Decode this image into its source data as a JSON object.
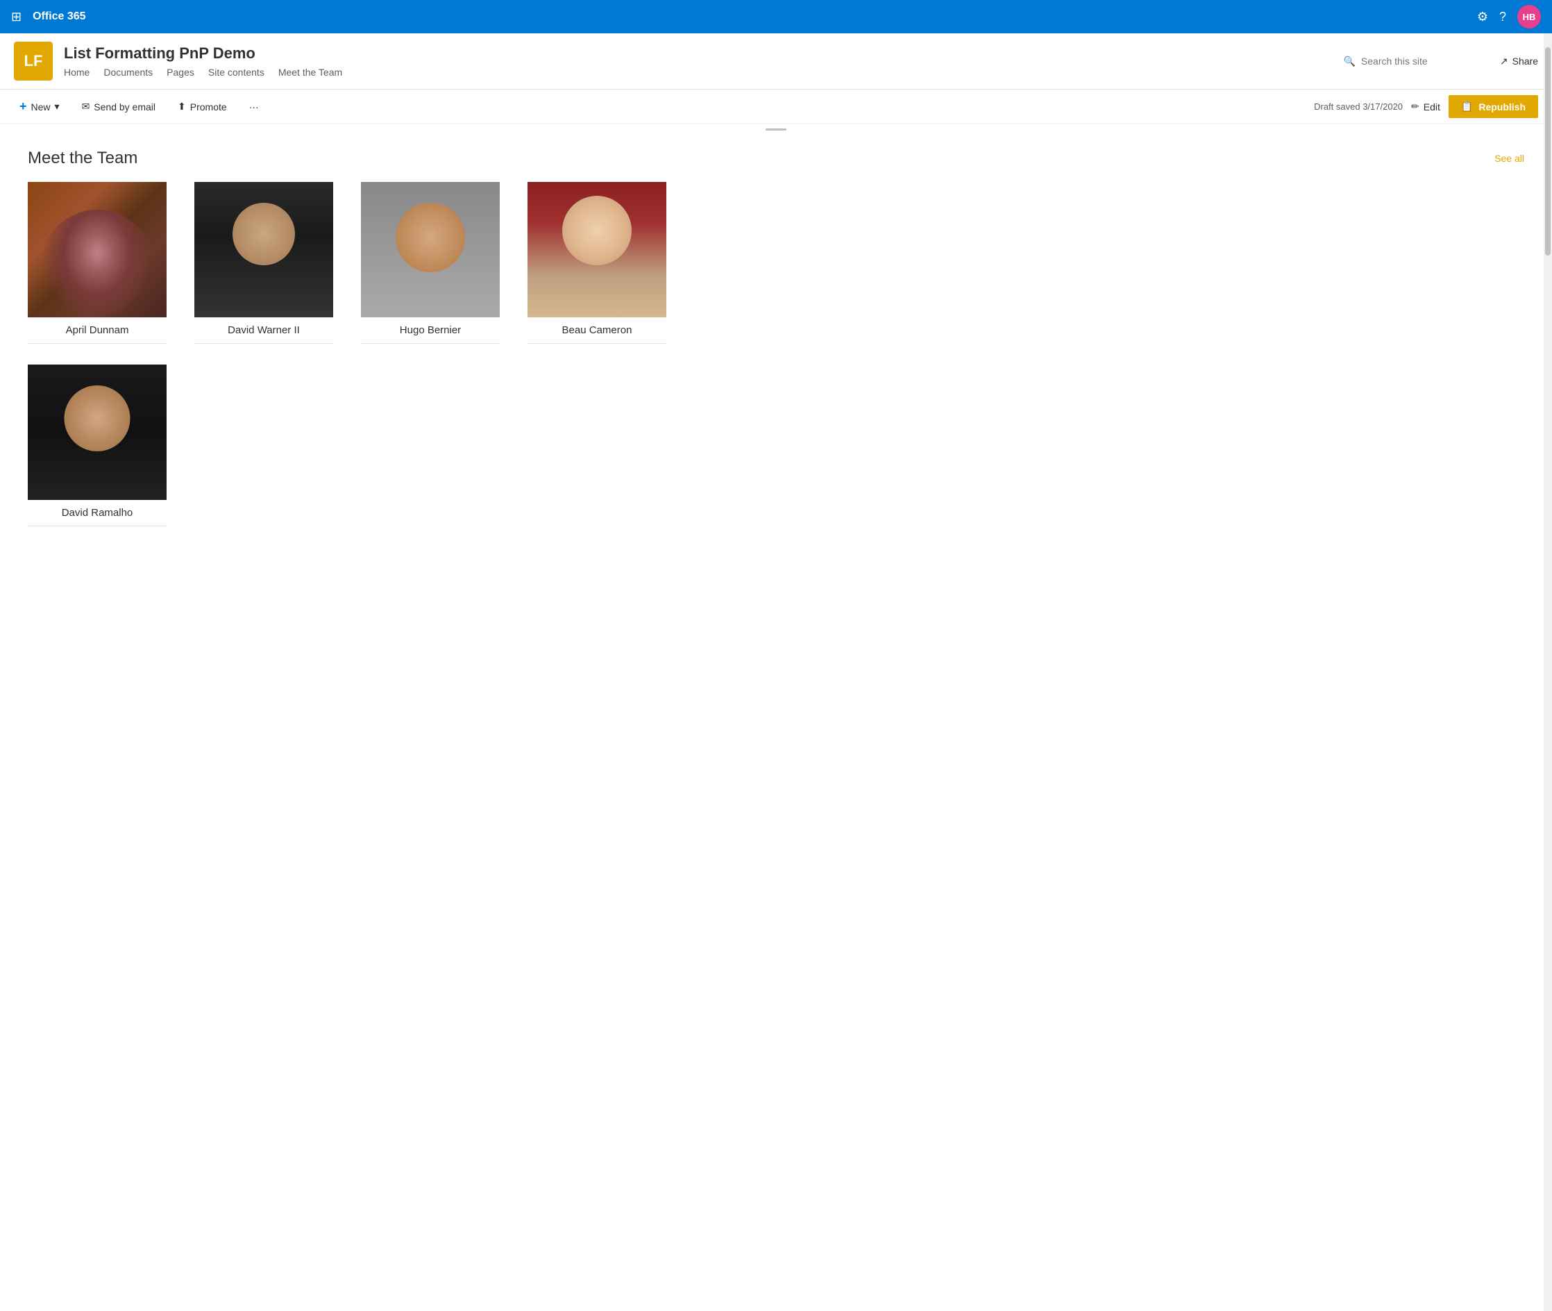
{
  "topNav": {
    "appName": "Office 365",
    "waffle": "⊞",
    "settingsIcon": "⚙",
    "helpIcon": "?",
    "avatar": "HB",
    "avatarBg": "#e83e8c"
  },
  "siteHeader": {
    "logoText": "LF",
    "logoBg": "#e0a800",
    "siteTitle": "List Formatting PnP Demo",
    "nav": [
      {
        "label": "Home"
      },
      {
        "label": "Documents"
      },
      {
        "label": "Pages"
      },
      {
        "label": "Site contents"
      },
      {
        "label": "Meet the Team"
      }
    ],
    "searchPlaceholder": "Search this site",
    "shareLabel": "Share"
  },
  "toolbar": {
    "newLabel": "New",
    "newChevron": "▾",
    "sendEmailLabel": "Send by email",
    "promoteLabel": "Promote",
    "moreLabel": "···",
    "draftSaved": "Draft saved 3/17/2020",
    "editLabel": "Edit",
    "republishLabel": "Republish"
  },
  "mainSection": {
    "sectionTitle": "Meet the Team",
    "seeAllLabel": "See all",
    "teamMembers": [
      {
        "name": "April Dunnam",
        "photoClass": "photo-april"
      },
      {
        "name": "David Warner II",
        "photoClass": "photo-david-w"
      },
      {
        "name": "Hugo Bernier",
        "photoClass": "photo-hugo"
      },
      {
        "name": "Beau Cameron",
        "photoClass": "photo-beau"
      },
      {
        "name": "David Ramalho",
        "photoClass": "photo-david-r"
      }
    ]
  }
}
